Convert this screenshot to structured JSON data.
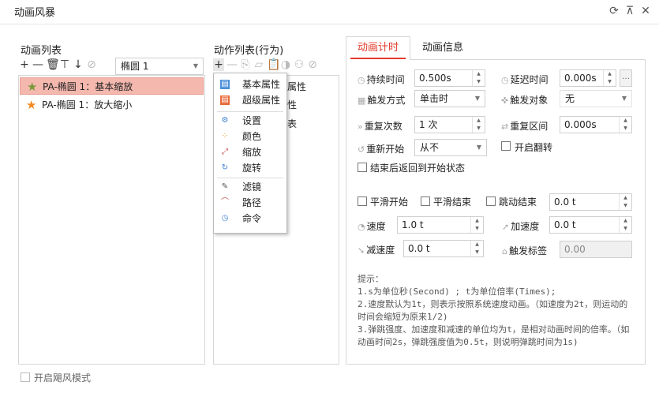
{
  "window": {
    "title": "动画风暴",
    "icons": [
      "refresh-icon",
      "pin-icon",
      "close-icon"
    ]
  },
  "anim_list": {
    "label": "动画列表",
    "target_select": "椭圆 1",
    "items": [
      {
        "label": "PA-椭圆 1：基本缩放",
        "selected": true,
        "icon_color": "#7a9a3a"
      },
      {
        "label": "PA-椭圆 1：放大缩小",
        "selected": false,
        "icon_color": "#f08a24"
      }
    ]
  },
  "action_list": {
    "label": "动作列表(行为)",
    "partial_rows": [
      "属性",
      "性",
      "表"
    ]
  },
  "context_menu": {
    "items": [
      {
        "label": "基本属性",
        "icon": "basic-props-icon"
      },
      {
        "label": "超级属性",
        "icon": "super-props-icon"
      },
      {
        "label": "设置",
        "icon": "settings-icon"
      },
      {
        "label": "颜色",
        "icon": "color-icon"
      },
      {
        "label": "缩放",
        "icon": "scale-icon"
      },
      {
        "label": "旋转",
        "icon": "rotate-icon"
      },
      {
        "label": "滤镜",
        "icon": "filter-icon"
      },
      {
        "label": "路径",
        "icon": "path-icon"
      },
      {
        "label": "命令",
        "icon": "command-icon"
      }
    ]
  },
  "tabs": [
    {
      "label": "动画计时",
      "active": true
    },
    {
      "label": "动画信息",
      "active": false
    }
  ],
  "timing": {
    "duration_label": "持续时间",
    "duration_value": "0.500s",
    "delay_label": "延迟时间",
    "delay_value": "0.000s",
    "trigger_label": "触发方式",
    "trigger_value": "单击时",
    "trigger_obj_label": "触发对象",
    "trigger_obj_value": "无",
    "repeat_label": "重复次数",
    "repeat_value": "1 次",
    "repeat_interval_label": "重复区间",
    "repeat_interval_value": "0.000s",
    "restart_label": "重新开始",
    "restart_value": "从不",
    "flip_label": "开启翻转",
    "return_label": "结束后返回到开始状态",
    "smooth_start_label": "平滑开始",
    "smooth_end_label": "平滑结束",
    "bounce_end_label": "跳动结束",
    "bounce_value": "0.0 t",
    "speed_label": "速度",
    "speed_value": "1.0 t",
    "accel_label": "加速度",
    "accel_value": "0.0 t",
    "decel_label": "减速度",
    "decel_value": "0.0 t",
    "trigger_tag_label": "触发标签",
    "trigger_tag_value": "0.00"
  },
  "tips": [
    "提示：",
    "  1.s为单位秒(Second) ;  t为单位倍率(Times);",
    "  2.速度默认为1t，则表示按照系统速度动画。（如速度为2t，则运动的时间会缩短为原来1/2)",
    "  3.弹跳强度、加速度和减速的单位均为t，是相对动画时间的倍率。（如动画时间2s，弹跳强度值为0.5t，则说明弹跳时间为1s)"
  ],
  "storm_mode_label": "开启飓风模式",
  "colors": {
    "accent": "#e23b2a",
    "selected_bg": "#f5b8ae"
  }
}
